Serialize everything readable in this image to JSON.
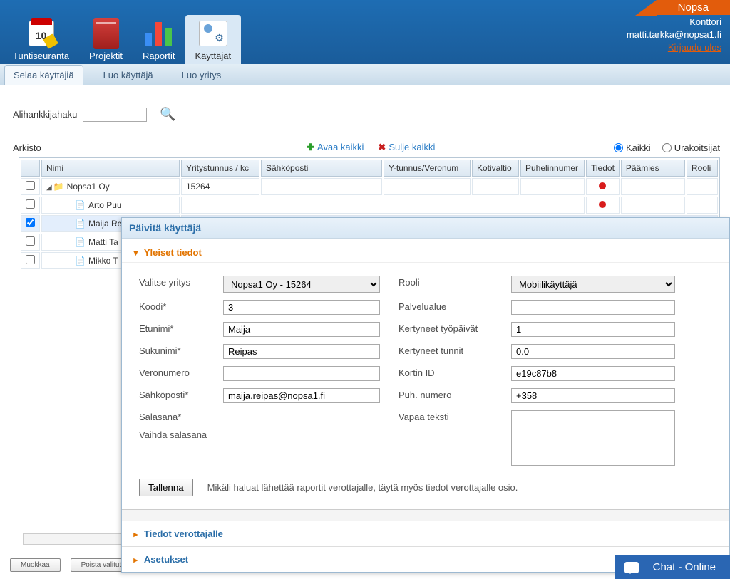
{
  "brand": "Nopsa",
  "user": {
    "org": "Konttori",
    "email": "matti.tarkka@nopsa1.fi",
    "logout": "Kirjaudu ulos"
  },
  "mainNav": {
    "tuntiseuranta": "Tuntiseuranta",
    "projektit": "Projektit",
    "raportit": "Raportit",
    "kayttajat": "Käyttäjät"
  },
  "subTabs": {
    "browse": "Selaa käyttäjiä",
    "createUser": "Luo käyttäjä",
    "createCompany": "Luo yritys"
  },
  "search": {
    "label": "Alihankkijahaku"
  },
  "arkisto": "Arkisto",
  "links": {
    "openAll": "Avaa kaikki",
    "closeAll": "Sulje kaikki"
  },
  "radios": {
    "all": "Kaikki",
    "contractors": "Urakoitsijat"
  },
  "columns": {
    "nimi": "Nimi",
    "yritystunnus": "Yritystunnus / kc",
    "sahkoposti": "Sähköposti",
    "ytunnus": "Y-tunnus/Veronum",
    "koti": "Kotivaltio",
    "puh": "Puhelinnumer",
    "tiedot": "Tiedot",
    "paamies": "Päämies",
    "rooli": "Rooli"
  },
  "rows": {
    "company": {
      "name": "Nopsa1 Oy",
      "code": "15264"
    },
    "r1": "Arto Puu",
    "r2": "Maija Re",
    "r3": "Matti Ta",
    "r4": "Mikko T"
  },
  "panel": {
    "title": "Päivitä käyttäjä",
    "sections": {
      "general": "Yleiset tiedot",
      "tax": "Tiedot verottajalle",
      "settings": "Asetukset"
    },
    "labels": {
      "valitseYritys": "Valitse yritys",
      "koodi": "Koodi*",
      "etunimi": "Etunimi*",
      "sukunimi": "Sukunimi*",
      "veronumero": "Veronumero",
      "sahkoposti": "Sähköposti*",
      "salasana": "Salasana*",
      "vaihda": "Vaihda salasana",
      "rooli": "Rooli",
      "palvelualue": "Palvelualue",
      "kertyneetP": "Kertyneet työpäivät",
      "kertyneetT": "Kertyneet tunnit",
      "kortin": "Kortin ID",
      "puh": "Puh. numero",
      "vapaa": "Vapaa teksti"
    },
    "values": {
      "yritys": "Nopsa1 Oy - 15264",
      "koodi": "3",
      "etunimi": "Maija",
      "sukunimi": "Reipas",
      "veronumero": "",
      "sahkoposti": "maija.reipas@nopsa1.fi",
      "rooli": "Mobiilikäyttäjä",
      "palvelualue": "",
      "kpv": "1",
      "kt": "0.0",
      "kortin": "e19c87b8",
      "puh": "+358",
      "vapaa": ""
    },
    "save": "Tallenna",
    "hint": "Mikäli haluat lähettää raportit verottajalle, täytä myös tiedot verottajalle osio."
  },
  "buttons": {
    "muokkaa": "Muokkaa",
    "poista": "Poista valitut"
  },
  "chat": "Chat - Online"
}
